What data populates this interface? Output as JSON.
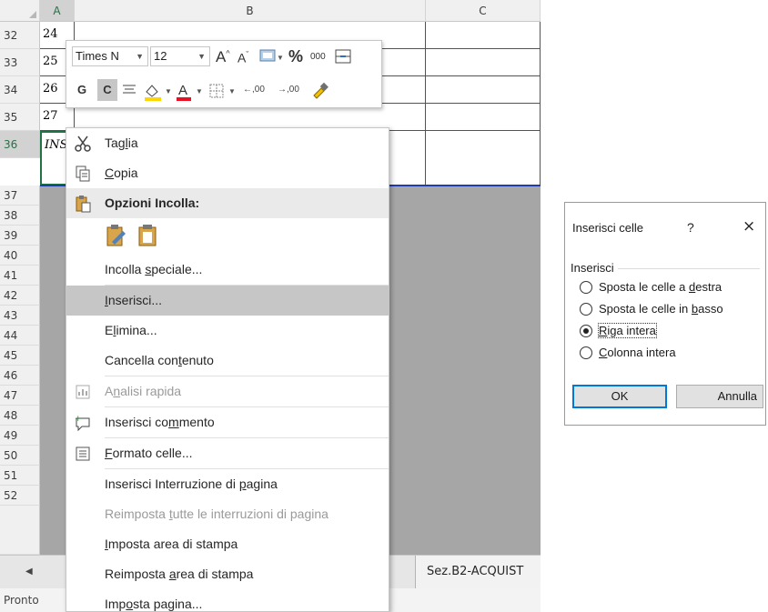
{
  "spreadsheet": {
    "columns": [
      "A",
      "B",
      "C"
    ],
    "rows": [
      "32",
      "33",
      "34",
      "35",
      "36",
      "37",
      "38",
      "39",
      "40",
      "41",
      "42",
      "43",
      "44",
      "45",
      "46",
      "47",
      "48",
      "49",
      "50",
      "51",
      "52"
    ],
    "cells": {
      "a32": "24",
      "a33": "25",
      "a34": "26",
      "a35": "27",
      "a36": "INS"
    },
    "sheet_tab": "Sez.B2-ACQUIST",
    "status": "Pronto"
  },
  "mini_toolbar": {
    "font": "Times N",
    "size": "12",
    "grow_font": "A",
    "shrink_font": "A",
    "percent": "%",
    "thousands": "000",
    "bold": "G",
    "italic": "C",
    "font_color": "A",
    "inc_decimal": ",00",
    "dec_decimal": ",00",
    "colors": {
      "highlight": "#ffd700",
      "font_color": "#e81123"
    }
  },
  "context_menu": {
    "items": [
      {
        "label": "Taglia",
        "icon": "scissors-icon",
        "access_key": "l"
      },
      {
        "label": "Copia",
        "icon": "copy-icon",
        "access_key": "C"
      },
      {
        "label": "Opzioni Incolla:",
        "icon": "paste-icon"
      },
      {
        "label": "Incolla speciale...",
        "access_key": "s"
      },
      {
        "label": "Inserisci...",
        "access_key": "I"
      },
      {
        "label": "Elimina...",
        "access_key": "l"
      },
      {
        "label": "Cancella contenuto",
        "access_key": "t"
      },
      {
        "label": "Analisi rapida",
        "icon": "quick-analysis-icon",
        "access_key": "n",
        "disabled": true
      },
      {
        "label": "Inserisci commento",
        "icon": "comment-icon",
        "access_key": "m"
      },
      {
        "label": "Formato celle...",
        "icon": "format-cells-icon",
        "access_key": "F"
      },
      {
        "label": "Inserisci Interruzione di pagina",
        "access_key": "p"
      },
      {
        "label": "Reimposta tutte le interruzioni di pagina",
        "access_key": "t",
        "disabled": true
      },
      {
        "label": "Imposta area di stampa",
        "access_key": "I"
      },
      {
        "label": "Reimposta area di stampa",
        "access_key": "a"
      },
      {
        "label": "Imposta pagina...",
        "access_key": "o"
      }
    ]
  },
  "dialog": {
    "title": "Inserisci celle",
    "help": "?",
    "close": "×",
    "group_label": "Inserisci",
    "options": [
      {
        "label": "Sposta le celle a destra",
        "checked": false
      },
      {
        "label": "Sposta le celle in basso",
        "checked": false
      },
      {
        "label": "Riga intera",
        "checked": true
      },
      {
        "label": "Colonna intera",
        "checked": false
      }
    ],
    "ok": "OK",
    "cancel": "Annulla"
  }
}
